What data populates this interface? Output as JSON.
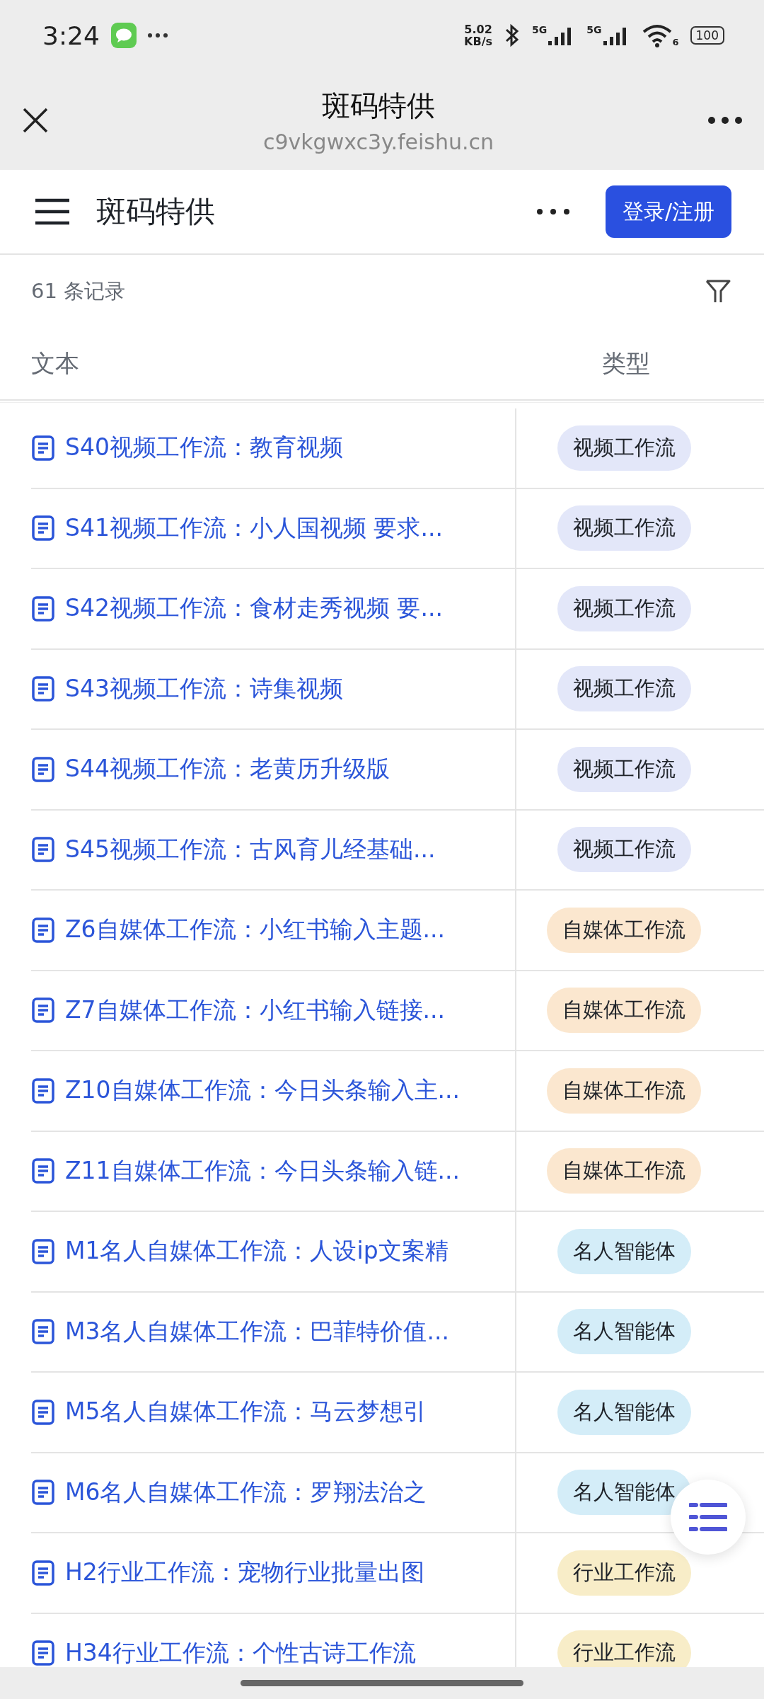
{
  "status_bar": {
    "time": "3:24",
    "speed_value": "5.02",
    "speed_unit": "KB/s",
    "sim_1": "5G",
    "sim_2": "5G",
    "wifi_version": "6",
    "battery": "100"
  },
  "browser_bar": {
    "title": "斑码特供",
    "url": "c9vkgwxc3y.feishu.cn"
  },
  "header": {
    "title": "斑码特供",
    "login_button": "登录/注册"
  },
  "record_count": "61 条记录",
  "table": {
    "columns": [
      "文本",
      "类型"
    ],
    "rows": [
      {
        "text": "S40视频工作流：教育视频",
        "type": "视频工作流",
        "color": "#e3e7f9"
      },
      {
        "text": "S41视频工作流：小人国视频 要求...",
        "type": "视频工作流",
        "color": "#e3e7f9"
      },
      {
        "text": "S42视频工作流：食材走秀视频 要...",
        "type": "视频工作流",
        "color": "#e3e7f9"
      },
      {
        "text": "S43视频工作流：诗集视频",
        "type": "视频工作流",
        "color": "#e3e7f9"
      },
      {
        "text": "S44视频工作流：老黄历升级版",
        "type": "视频工作流",
        "color": "#e3e7f9"
      },
      {
        "text": "S45视频工作流：古风育儿经基础...",
        "type": "视频工作流",
        "color": "#e3e7f9"
      },
      {
        "text": "Z6自媒体工作流：小红书输入主题...",
        "type": "自媒体工作流",
        "color": "#fbe7cf"
      },
      {
        "text": "Z7自媒体工作流：小红书输入链接...",
        "type": "自媒体工作流",
        "color": "#fbe7cf"
      },
      {
        "text": "Z10自媒体工作流：今日头条输入主...",
        "type": "自媒体工作流",
        "color": "#fbe7cf"
      },
      {
        "text": "Z11自媒体工作流：今日头条输入链...",
        "type": "自媒体工作流",
        "color": "#fbe7cf"
      },
      {
        "text": "M1名人自媒体工作流：人设ip文案精",
        "type": "名人智能体",
        "color": "#d4edf8"
      },
      {
        "text": "M3名人自媒体工作流：巴菲特价值...",
        "type": "名人智能体",
        "color": "#d4edf8"
      },
      {
        "text": "M5名人自媒体工作流：马云梦想引",
        "type": "名人智能体",
        "color": "#d4edf8"
      },
      {
        "text": "M6名人自媒体工作流：罗翔法治之",
        "type": "名人智能体",
        "color": "#d4edf8"
      },
      {
        "text": "H2行业工作流：宠物行业批量出图",
        "type": "行业工作流",
        "color": "#f8edc8"
      },
      {
        "text": "H34行业工作流：个性古诗工作流",
        "type": "行业工作流",
        "color": "#f8edc8"
      }
    ]
  }
}
